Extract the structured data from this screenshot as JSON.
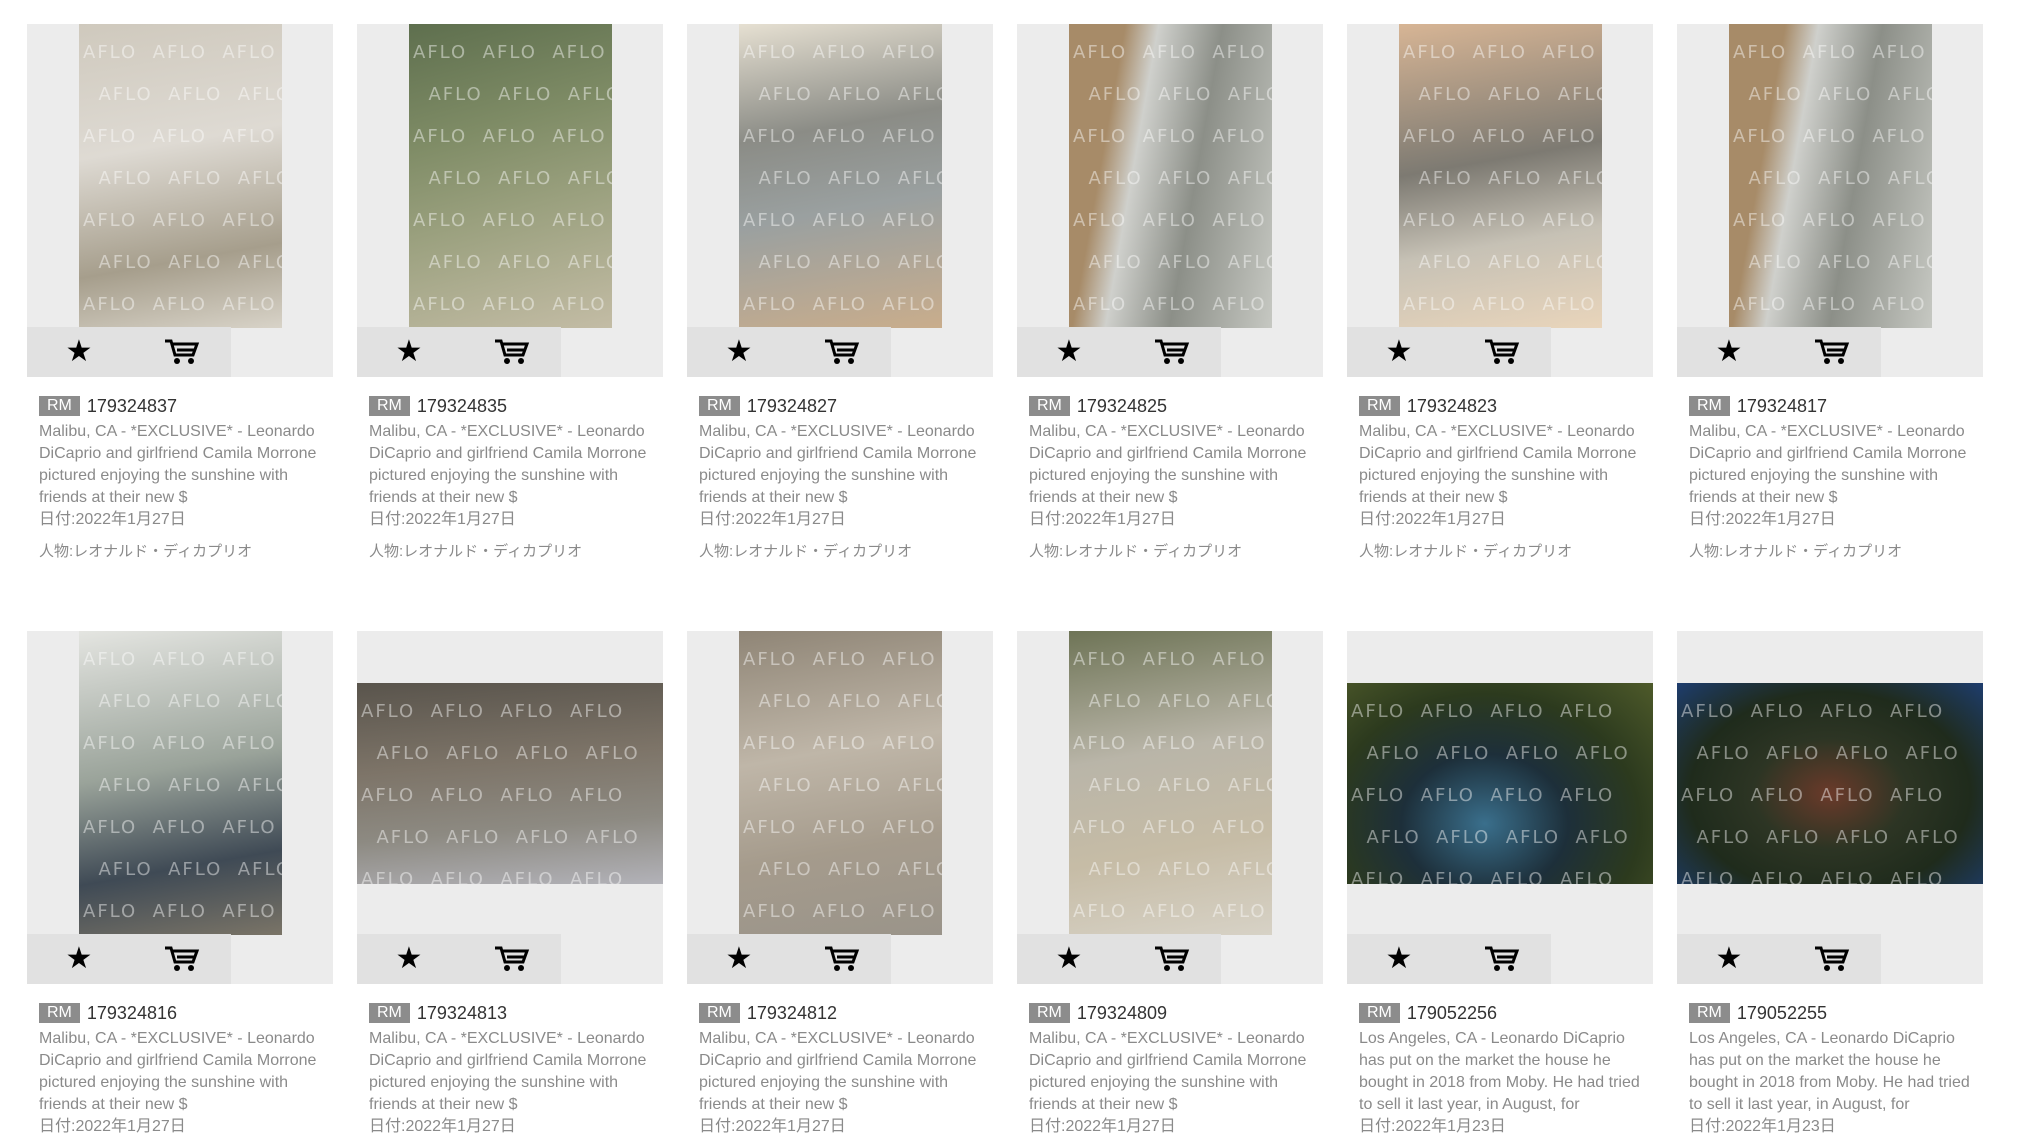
{
  "watermark": "AFLO",
  "labels": {
    "rights_badge": "RM",
    "date_prefix": "日付:",
    "person_prefix": "人物:"
  },
  "icons": {
    "favorite": "star-icon",
    "cart": "cart-icon"
  },
  "colors": {
    "badge_bg": "#8c8c8c",
    "card_bg": "#ececec",
    "toolbar_bg": "#e1e1e1",
    "meta_text": "#8a8a8a"
  },
  "results": [
    {
      "id": "179324837",
      "desc": "Malibu, CA - *EXCLUSIVE* - Leonardo DiCaprio and girlfriend Camila Morrone pictured enjoying the sunshine with friends at their new $",
      "date": "2022年1月27日",
      "person": "レオナルド・ディカプリオ"
    },
    {
      "id": "179324835",
      "desc": "Malibu, CA - *EXCLUSIVE* - Leonardo DiCaprio and girlfriend Camila Morrone pictured enjoying the sunshine with friends at their new $",
      "date": "2022年1月27日",
      "person": "レオナルド・ディカプリオ"
    },
    {
      "id": "179324827",
      "desc": "Malibu, CA - *EXCLUSIVE* - Leonardo DiCaprio and girlfriend Camila Morrone pictured enjoying the sunshine with friends at their new $",
      "date": "2022年1月27日",
      "person": "レオナルド・ディカプリオ"
    },
    {
      "id": "179324825",
      "desc": "Malibu, CA - *EXCLUSIVE* - Leonardo DiCaprio and girlfriend Camila Morrone pictured enjoying the sunshine with friends at their new $",
      "date": "2022年1月27日",
      "person": "レオナルド・ディカプリオ"
    },
    {
      "id": "179324823",
      "desc": "Malibu, CA - *EXCLUSIVE* - Leonardo DiCaprio and girlfriend Camila Morrone pictured enjoying the sunshine with friends at their new $",
      "date": "2022年1月27日",
      "person": "レオナルド・ディカプリオ"
    },
    {
      "id": "179324817",
      "desc": "Malibu, CA - *EXCLUSIVE* - Leonardo DiCaprio and girlfriend Camila Morrone pictured enjoying the sunshine with friends at their new $",
      "date": "2022年1月27日",
      "person": "レオナルド・ディカプリオ"
    },
    {
      "id": "179324816",
      "desc": "Malibu, CA - *EXCLUSIVE* - Leonardo DiCaprio and girlfriend Camila Morrone pictured enjoying the sunshine with friends at their new $",
      "date": "2022年1月27日",
      "person": ""
    },
    {
      "id": "179324813",
      "desc": "Malibu, CA - *EXCLUSIVE* - Leonardo DiCaprio and girlfriend Camila Morrone pictured enjoying the sunshine with friends at their new $",
      "date": "2022年1月27日",
      "person": ""
    },
    {
      "id": "179324812",
      "desc": "Malibu, CA - *EXCLUSIVE* - Leonardo DiCaprio and girlfriend Camila Morrone pictured enjoying the sunshine with friends at their new $",
      "date": "2022年1月27日",
      "person": ""
    },
    {
      "id": "179324809",
      "desc": "Malibu, CA - *EXCLUSIVE* - Leonardo DiCaprio and girlfriend Camila Morrone pictured enjoying the sunshine with friends at their new $",
      "date": "2022年1月27日",
      "person": ""
    },
    {
      "id": "179052256",
      "desc": "Los Angeles, CA - Leonardo DiCaprio has put on the market the house he bought in 2018 from Moby. He had tried to sell it last year, in August, for",
      "date": "2022年1月23日",
      "person": ""
    },
    {
      "id": "179052255",
      "desc": "Los Angeles, CA - Leonardo DiCaprio has put on the market the house he bought in 2018 from Moby. He had tried to sell it last year, in August, for",
      "date": "2022年1月23日",
      "person": ""
    }
  ]
}
